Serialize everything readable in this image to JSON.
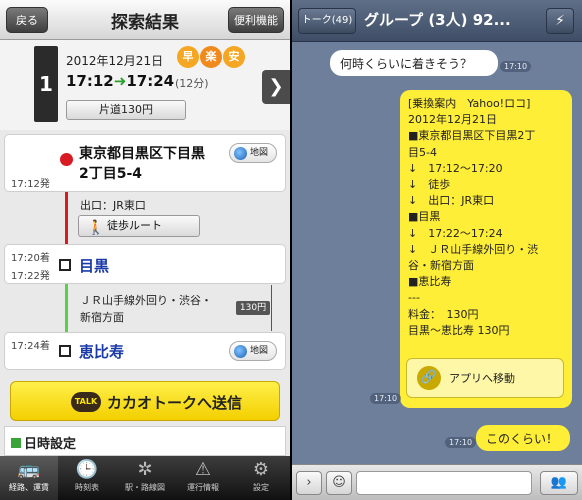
{
  "left": {
    "nav": {
      "back_label": "戻る",
      "title": "探索結果",
      "util_label": "便利機能"
    },
    "route": {
      "number": "1",
      "date": "2012年12月21日",
      "badges": [
        {
          "label": "早",
          "color": "#f5a623"
        },
        {
          "label": "楽",
          "color": "#f08a1c"
        },
        {
          "label": "安",
          "color": "#f5a623"
        }
      ],
      "depart": "17:12",
      "arrive": "17:24",
      "duration": "(12分)",
      "fare": "片道130円"
    },
    "origin": {
      "name_line1": "東京都目黒区下目黒",
      "name_line2": "2丁目5-4",
      "time": "17:12発",
      "map_label": "地図"
    },
    "exit_label": "出口：JR東口",
    "walk_label": "徒歩ルート",
    "meguro": {
      "arr": "17:20着",
      "dep": "17:22発",
      "name": "目黒"
    },
    "line": {
      "name_line1": "ＪＲ山手線外回り・渋谷・",
      "name_line2": "新宿方面",
      "fare": "130円"
    },
    "ebisu": {
      "arr": "17:24着",
      "name": "恵比寿",
      "map_label": "地図"
    },
    "send": {
      "logo": "TALK",
      "label": "カカオトークへ送信"
    },
    "date_section": "日時設定",
    "tabs": [
      {
        "label": "経路、運賃",
        "icon": "bus-icon"
      },
      {
        "label": "時刻表",
        "icon": "timetable-icon"
      },
      {
        "label": "駅・路線図",
        "icon": "route-map-icon"
      },
      {
        "label": "運行情報",
        "icon": "warning-icon"
      },
      {
        "label": "設定",
        "icon": "gear-icon"
      }
    ]
  },
  "right": {
    "nav": {
      "back_label": "トーク(49)",
      "title": "グループ (3人) 92...",
      "menu_icon": "menu-icon"
    },
    "msg1": {
      "text": "何時くらいに着きそう？",
      "time": "17:10"
    },
    "msg2": {
      "lines": [
        "[乗換案内　Yahoo!ロコ]",
        "2012年12月21日",
        "■東京都目黒区下目黒2丁",
        "目5-4",
        "↓　17:12〜17:20",
        "↓　徒歩",
        "↓　出口：JR東口",
        "■目黒",
        "↓　17:22〜17:24",
        "↓　ＪＲ山手線外回り・渋",
        "谷・新宿方面",
        "■恵比寿",
        "---",
        "料金：　130円",
        "目黒〜恵比寿 130円"
      ],
      "link_label": "アプリへ移動",
      "time": "17:10"
    },
    "msg3": {
      "text": "このくらい！",
      "time": "17:10"
    }
  }
}
